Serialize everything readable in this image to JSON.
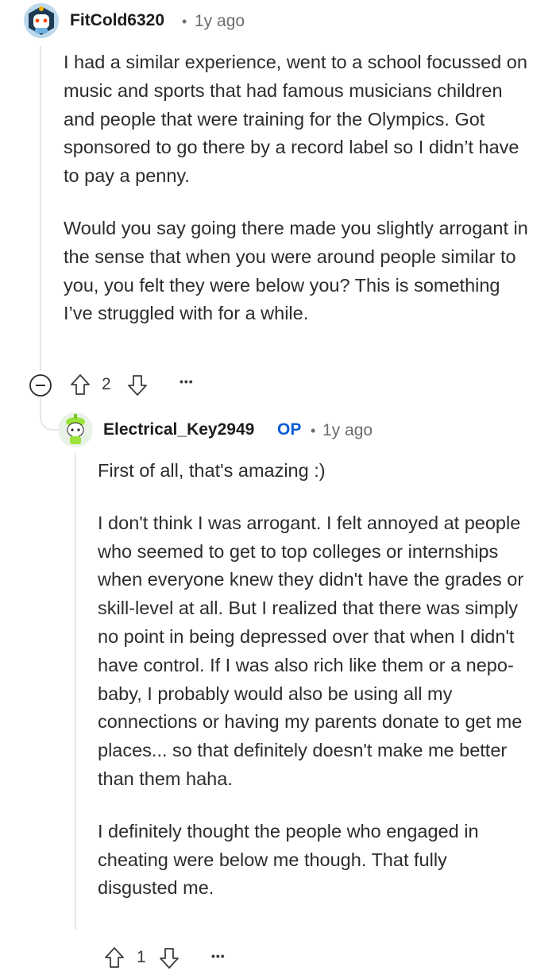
{
  "comment1": {
    "username": "FitCold6320",
    "separator": "•",
    "timestamp": "1y ago",
    "avatar": "snoo-avatar-icon",
    "paragraphs": [
      "I had a similar experience, went to a school focussed on music and sports that had famous musicians children and people that were training for the Olympics. Got sponsored to go there by a record label so I didn’t have to pay a penny.",
      "Would you say going there made you slightly arrogant in the sense that when you were around people similar to you, you felt they were below you? This is something I’ve struggled with for a while."
    ],
    "votes": "2",
    "more": "•••"
  },
  "comment2": {
    "username": "Electrical_Key2949",
    "badge": "OP",
    "separator": "•",
    "timestamp": "1y ago",
    "avatar": "snoo-avatar-icon",
    "paragraphs": [
      "First of all, that's amazing :)",
      "I don't think I was arrogant. I felt annoyed at people who seemed to get to top colleges or internships when everyone knew they didn't have the grades or skill-level at all. But I realized that there was simply no point in being depressed over that when I didn't have control. If I was also rich like them or a nepo-baby, I probably would also be using all my connections or having my parents donate to get me places... so that definitely doesn't make me better than them haha.",
      "I definitely thought the people who engaged in cheating were below me though. That fully disgusted me."
    ],
    "votes": "1",
    "more": "•••"
  },
  "colors": {
    "text": "#2a2d30",
    "meta": "#6a6d70",
    "op_badge": "#0a5bd6",
    "thread_line": "#e5e7e9"
  }
}
